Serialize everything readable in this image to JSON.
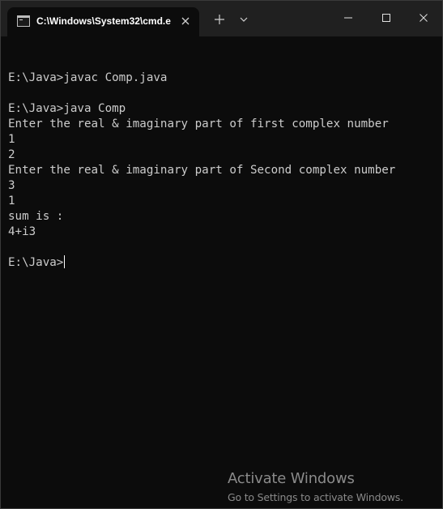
{
  "window": {
    "tab_title": "C:\\Windows\\System32\\cmd.e",
    "icons": {
      "tab": "terminal-icon",
      "tab_close": "close-icon",
      "new_tab": "plus-icon",
      "dropdown": "chevron-down-icon",
      "minimize": "minimize-icon",
      "maximize": "maximize-icon",
      "close": "close-icon"
    }
  },
  "terminal": {
    "lines": [
      "",
      "E:\\Java>javac Comp.java",
      "",
      "E:\\Java>java Comp",
      "Enter the real & imaginary part of first complex number",
      "1",
      "2",
      "Enter the real & imaginary part of Second complex number",
      "3",
      "1",
      "sum is :",
      "4+i3",
      ""
    ],
    "prompt": "E:\\Java>"
  },
  "watermark": {
    "title": "Activate Windows",
    "subtitle": "Go to Settings to activate Windows."
  },
  "colors": {
    "background": "#0c0c0c",
    "titlebar": "#202020",
    "text": "#cccccc",
    "watermark": "#8a8a8a"
  }
}
